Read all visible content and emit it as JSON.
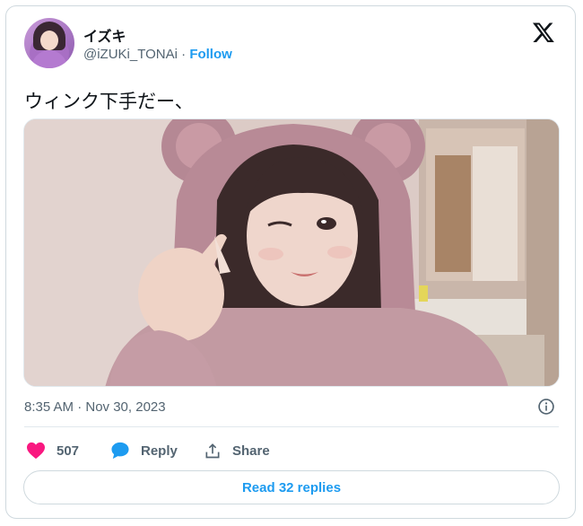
{
  "author": {
    "display_name": "イズキ",
    "handle": "@iZUKi_TONAi",
    "separator": "·",
    "follow_label": "Follow"
  },
  "tweet": {
    "text": "ウィンク下手だー、",
    "timestamp": "8:35 AM · Nov 30, 2023"
  },
  "actions": {
    "like_count": "507",
    "reply_label": "Reply",
    "share_label": "Share",
    "read_replies_label": "Read 32 replies"
  },
  "icons": {
    "brand": "x-logo-icon",
    "info": "info-icon",
    "like": "heart-icon",
    "reply": "speech-bubble-icon",
    "share": "share-upload-icon"
  },
  "colors": {
    "accent": "#1d9bf0",
    "like": "#f91880",
    "muted_text": "#536471",
    "text": "#0f1419",
    "border": "#cfd9de"
  }
}
